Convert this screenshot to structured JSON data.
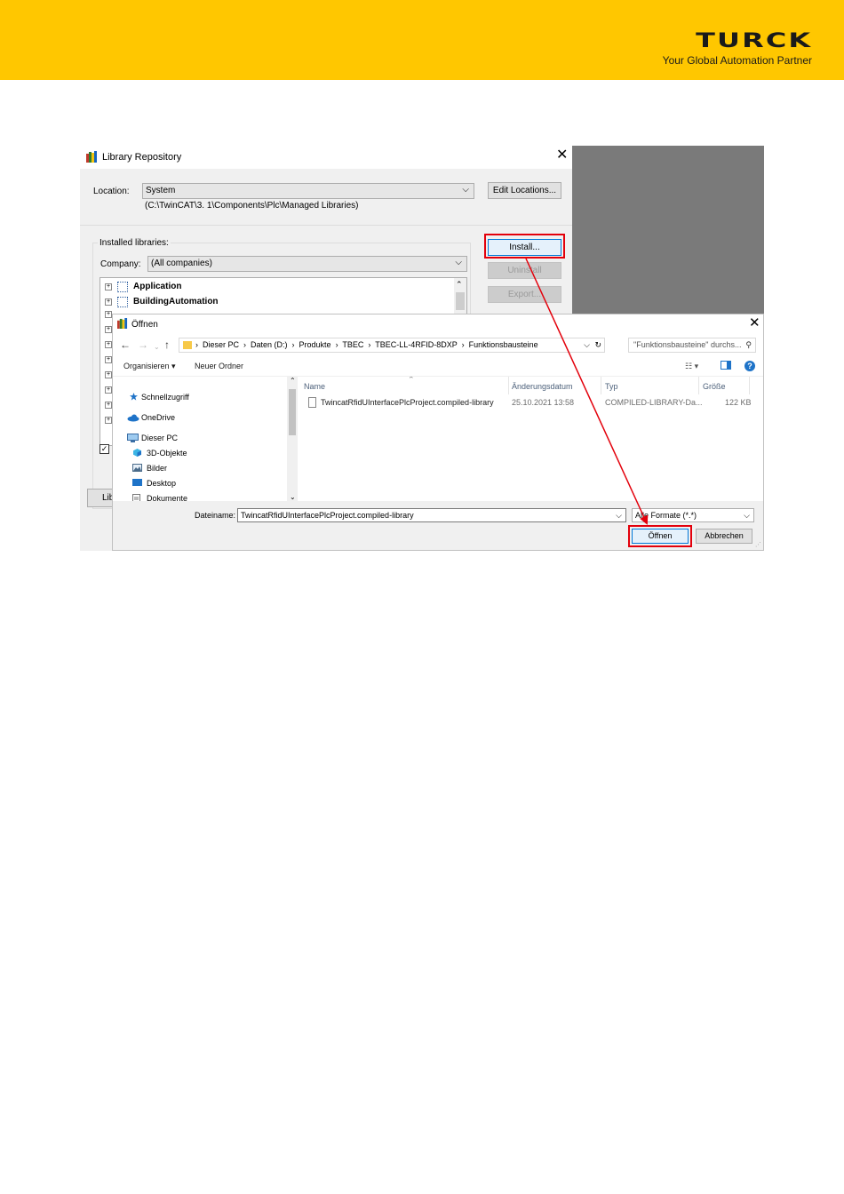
{
  "brand": {
    "logo_word": "TURCK",
    "tagline": "Your Global Automation Partner",
    "header_color": "#FFC700"
  },
  "library_repository": {
    "title": "Library Repository",
    "location_label": "Location:",
    "location_value": "System",
    "location_path": "(C:\\TwinCAT\\3. 1\\Components\\Plc\\Managed Libraries)",
    "edit_locations_button": "Edit Locations...",
    "installed_libraries_label": "Installed libraries:",
    "company_label": "Company:",
    "company_value": "(All companies)",
    "install_button": "Install...",
    "uninstall_button": "Uninstall",
    "export_button": "Export...",
    "library_items": [
      "Application",
      "BuildingAutomation"
    ],
    "bottom_button_partial": "Lib"
  },
  "open_dialog": {
    "title": "Öffnen",
    "breadcrumb": [
      "Dieser PC",
      "Daten (D:)",
      "Produkte",
      "TBEC",
      "TBEC-LL-4RFID-8DXP",
      "Funktionsbausteine"
    ],
    "search_placeholder": "\"Funktionsbausteine\" durchs...",
    "toolbar": {
      "organize": "Organisieren ▾",
      "new_folder": "Neuer Ordner"
    },
    "nav_items": [
      "Schnellzugriff",
      "OneDrive",
      "Dieser PC",
      "3D-Objekte",
      "Bilder",
      "Desktop",
      "Dokumente"
    ],
    "columns": [
      "Name",
      "Änderungsdatum",
      "Typ",
      "Größe"
    ],
    "files": [
      {
        "name": "TwincatRfidUInterfacePlcProject.compiled-library",
        "modified": "25.10.2021 13:58",
        "type": "COMPILED-LIBRARY-Da...",
        "size": "122 KB"
      }
    ],
    "filename_label": "Dateiname:",
    "filename_value": "TwincatRfidUInterfacePlcProject.compiled-library",
    "filetype_value": "Alle Formate (*.*)",
    "open_button": "Öffnen",
    "cancel_button": "Abbrechen"
  },
  "annotation": {
    "highlight_color": "#e3000b"
  }
}
